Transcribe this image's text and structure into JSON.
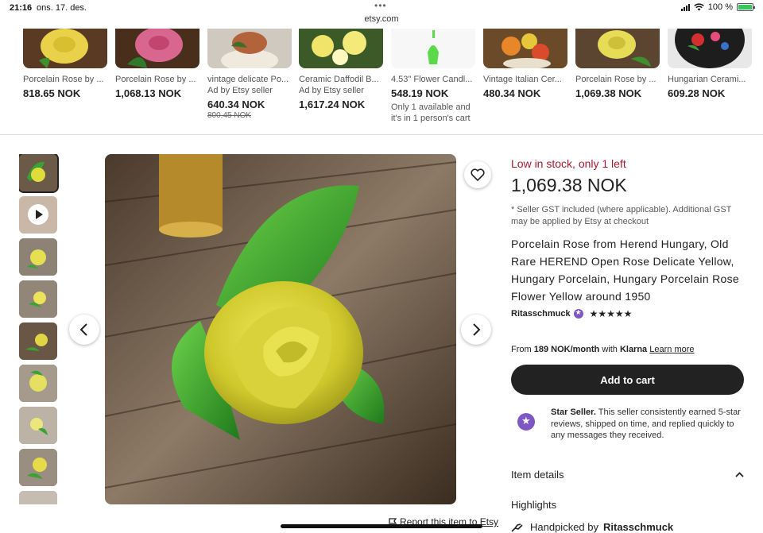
{
  "status_bar": {
    "time": "21:16",
    "date": "ons. 17. des.",
    "url": "etsy.com",
    "battery": "100 %"
  },
  "recommendations": [
    {
      "title": "Porcelain Rose by ...",
      "price": "818.65 NOK"
    },
    {
      "title": "Porcelain Rose by ...",
      "price": "1,068.13 NOK"
    },
    {
      "title": "vintage delicate Po...",
      "ad": "Ad by Etsy seller",
      "price": "640.34 NOK",
      "old_price": "800.45 NOK"
    },
    {
      "title": "Ceramic Daffodil B...",
      "ad": "Ad by Etsy seller",
      "price": "1,617.24 NOK"
    },
    {
      "title": "4.53\" Flower Candl...",
      "price": "548.19 NOK",
      "availability": "Only 1 available and it's in 1 person's cart"
    },
    {
      "title": "Vintage Italian Cer...",
      "price": "480.34 NOK"
    },
    {
      "title": "Porcelain Rose by ...",
      "price": "1,069.38 NOK"
    },
    {
      "title": "Hungarian Cerami...",
      "price": "609.28 NOK"
    }
  ],
  "product": {
    "stock_note": "Low in stock, only 1 left",
    "price": "1,069.38 NOK",
    "gst_note": "* Seller GST included (where applicable). Additional GST may be applied by Etsy at checkout",
    "title": "Porcelain Rose from Herend Hungary, Old Rare HEREND Open Rose Delicate Yellow, Hungary Porcelain, Hungary Porcelain Rose Flower Yellow around 1950",
    "shop_name": "Ritasschmuck",
    "rating_stars": "★★★★★",
    "rating_value": 5,
    "klarna_from": "From",
    "klarna_amount": "189 NOK/month",
    "klarna_with": "with",
    "klarna_brand": "Klarna",
    "klarna_learn": "Learn more",
    "add_to_cart": "Add to cart",
    "star_seller_label": "Star Seller.",
    "star_seller_text": "This seller consistently earned 5-star reviews, shipped on time, and replied quickly to any messages they received.",
    "item_details": "Item details",
    "highlights": "Highlights",
    "handpicked_prefix": "Handpicked by",
    "handpicked_shop": "Ritasschmuck",
    "report": "Report this item to Etsy"
  },
  "colors": {
    "stock_red": "#a61a2e",
    "button_dark": "#222222",
    "star_seller_purple": "#7e57c2"
  }
}
